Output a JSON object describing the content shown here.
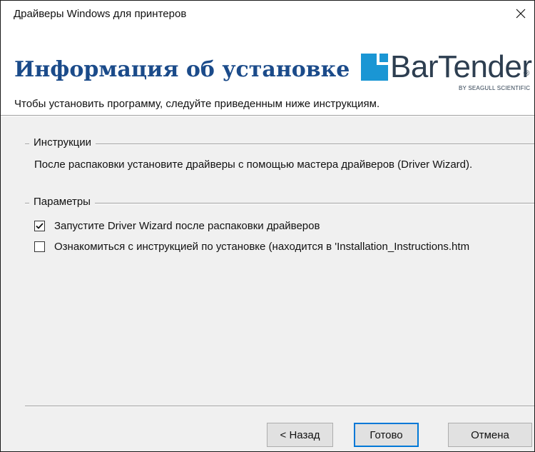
{
  "window": {
    "title": "Драйверы Windows для принтеров",
    "close_icon": "close-icon"
  },
  "header": {
    "title": "Информация об установке",
    "subtitle": "Чтобы установить программу, следуйте приведенным ниже инструкциям.",
    "logo": {
      "text": "BarTender",
      "registered": "®",
      "byline": "BY SEAGULL SCIENTIFIC",
      "colors": {
        "mark": "#1a96d4",
        "text": "#2d3e50"
      }
    }
  },
  "instructions": {
    "group_label": "Инструкции",
    "text": "После распаковки установите драйверы с помощью мастера драйверов (Driver Wizard)."
  },
  "parameters": {
    "group_label": "Параметры",
    "options": [
      {
        "label": "Запустите Driver Wizard после распаковки драйверов",
        "checked": true
      },
      {
        "label": "Ознакомиться с инструкцией по установке (находится в 'Installation_Instructions.htm",
        "checked": false
      }
    ]
  },
  "buttons": {
    "back": "< Назад",
    "finish": "Готово",
    "cancel": "Отмена"
  },
  "colors": {
    "title_blue": "#1b4b8a",
    "dialog_bg": "#f0f0f0",
    "focus_border": "#0078d7"
  }
}
